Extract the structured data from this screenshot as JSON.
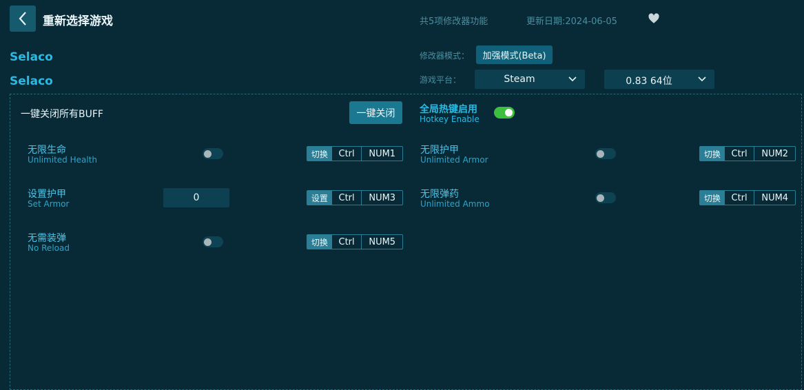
{
  "header": {
    "title": "重新选择游戏",
    "feature_count": "共5项修改器功能",
    "update_date": "更新日期:2024-06-05"
  },
  "game": {
    "name": "Selaco",
    "name_en": "Selaco"
  },
  "settings": {
    "mode_label": "修改器模式：",
    "mode_value": "加强模式(Beta)",
    "platform_label": "游戏平台：",
    "platform_value": "Steam",
    "version_value": "0.83 64位"
  },
  "panel": {
    "buff_label": "一键关闭所有BUFF",
    "close_all_label": "一键关闭",
    "hotkey_cn": "全局热键启用",
    "hotkey_en": "Hotkey Enable",
    "hotkey_enabled": true
  },
  "options": [
    {
      "cn": "无限生命",
      "en": "Unlimited Health",
      "action": "切换",
      "mod": "Ctrl",
      "key": "NUM1",
      "on": false
    },
    {
      "cn": "无限护甲",
      "en": "Unlimited Armor",
      "action": "切换",
      "mod": "Ctrl",
      "key": "NUM2",
      "on": false
    },
    {
      "cn": "设置护甲",
      "en": "Set Armor",
      "action": "设置",
      "mod": "Ctrl",
      "key": "NUM3",
      "value": "0"
    },
    {
      "cn": "无限弹药",
      "en": "Unlimited Ammo",
      "action": "切换",
      "mod": "Ctrl",
      "key": "NUM4",
      "on": false
    },
    {
      "cn": "无需装弹",
      "en": "No Reload",
      "action": "切换",
      "mod": "Ctrl",
      "key": "NUM5",
      "on": false
    }
  ],
  "colors": {
    "background": "#082a36",
    "accent": "#29b9e3",
    "toggle_on": "#3dbf3f"
  },
  "icons": [
    "back-arrow-icon",
    "heart-icon",
    "chevron-down-icon"
  ]
}
